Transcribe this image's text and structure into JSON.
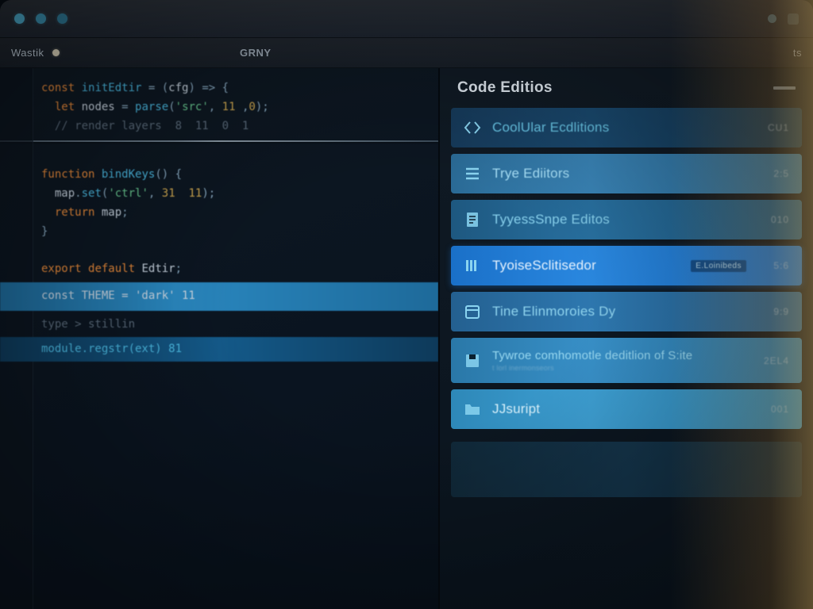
{
  "titlebar": {
    "traffic_colors": [
      "#4aa8c9",
      "#3a90b0",
      "#2f7a98"
    ]
  },
  "toolbar": {
    "active_tab": "Wastik",
    "center_label": "GRNY",
    "right_label": "ts"
  },
  "editor": {
    "lines": [
      {
        "tokens": [
          [
            "kw",
            "const"
          ],
          [
            "id",
            " "
          ],
          [
            "fn",
            "initEdtir"
          ],
          [
            "op",
            " = ("
          ],
          [
            "id",
            "cfg"
          ],
          [
            "op",
            ") => {"
          ]
        ]
      },
      {
        "tokens": [
          [
            "id",
            "  "
          ],
          [
            "kw",
            "let"
          ],
          [
            "id",
            " "
          ],
          [
            "id",
            "nodes"
          ],
          [
            "op",
            " = "
          ],
          [
            "fn",
            "parse"
          ],
          [
            "op",
            "("
          ],
          [
            "str",
            "'src'"
          ],
          [
            "op",
            ", "
          ],
          [
            "num",
            "11"
          ],
          [
            "op",
            " ,"
          ],
          [
            "num",
            "0"
          ],
          [
            "op",
            ");"
          ]
        ]
      },
      {
        "tokens": [
          [
            "id",
            "  "
          ],
          [
            "cm",
            "// render layers  8  11  0  1"
          ]
        ]
      },
      {
        "tokens": []
      },
      {
        "tokens": [
          [
            "kw",
            "function"
          ],
          [
            "id",
            " "
          ],
          [
            "fn",
            "bindKeys"
          ],
          [
            "op",
            "() {"
          ]
        ]
      },
      {
        "tokens": [
          [
            "id",
            "  "
          ],
          [
            "id",
            "map"
          ],
          [
            "op",
            "."
          ],
          [
            "fn",
            "set"
          ],
          [
            "op",
            "("
          ],
          [
            "str",
            "'ctrl'"
          ],
          [
            "op",
            ", "
          ],
          [
            "num",
            "31"
          ],
          [
            "op",
            "  "
          ],
          [
            "num",
            "11"
          ],
          [
            "op",
            ");"
          ]
        ]
      },
      {
        "tokens": [
          [
            "id",
            "  "
          ],
          [
            "kw",
            "return"
          ],
          [
            "id",
            " "
          ],
          [
            "id",
            "map"
          ],
          [
            "op",
            ";"
          ]
        ]
      },
      {
        "tokens": [
          [
            "op",
            "}"
          ]
        ]
      },
      {
        "tokens": []
      },
      {
        "tokens": [
          [
            "kw",
            "export"
          ],
          [
            "id",
            " "
          ],
          [
            "kw",
            "default"
          ],
          [
            "id",
            " "
          ],
          [
            "id",
            "Edtir"
          ],
          [
            "op",
            ";"
          ]
        ]
      }
    ],
    "selected_line_a": "const THEME = 'dark'   11",
    "small_line": "type > stillin",
    "selected_line_b": "module.regstr(ext)  81"
  },
  "panel": {
    "title": "Code Editios",
    "items": [
      {
        "icon": "code-icon",
        "label": "CoolUlar Ecdlitions",
        "meta": "CU1",
        "variant": "t1"
      },
      {
        "icon": "list-icon",
        "label": "Trye Ediitors",
        "meta": "2:5",
        "variant": "t2"
      },
      {
        "icon": "doc-icon",
        "label": "TyyessSnpe Editos",
        "meta": "010",
        "variant": "t3"
      },
      {
        "icon": "bars-icon",
        "label": "TyoiseSclitisedor",
        "meta": "5:6",
        "variant": "sel",
        "badge": "E.Loinibeds"
      },
      {
        "icon": "calendar-icon",
        "label": "Tine Elinmoroies Dy",
        "meta": "9:9",
        "variant": "t4"
      },
      {
        "icon": "save-icon",
        "label": "Tywroe comhomotle deditlion of S:ite",
        "sub": "t lorl inermonseors",
        "meta": "2EL4",
        "variant": "t5"
      },
      {
        "icon": "folder-icon",
        "label": "JJsuript",
        "meta": "001",
        "variant": "t6"
      }
    ]
  }
}
